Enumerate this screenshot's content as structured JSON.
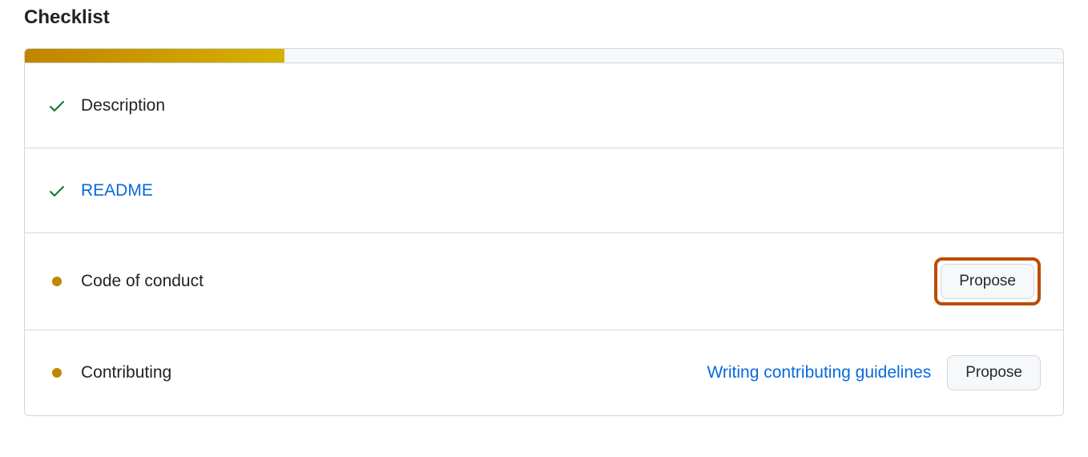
{
  "header": {
    "title": "Checklist"
  },
  "progress": {
    "percent": 25
  },
  "items": [
    {
      "status": "done",
      "label": "Description",
      "isLink": false,
      "helpLink": null,
      "action": null,
      "highlight": false
    },
    {
      "status": "done",
      "label": "README",
      "isLink": true,
      "helpLink": null,
      "action": null,
      "highlight": false
    },
    {
      "status": "pending",
      "label": "Code of conduct",
      "isLink": false,
      "helpLink": null,
      "action": "Propose",
      "highlight": true
    },
    {
      "status": "pending",
      "label": "Contributing",
      "isLink": false,
      "helpLink": "Writing contributing guidelines",
      "action": "Propose",
      "highlight": false
    }
  ]
}
